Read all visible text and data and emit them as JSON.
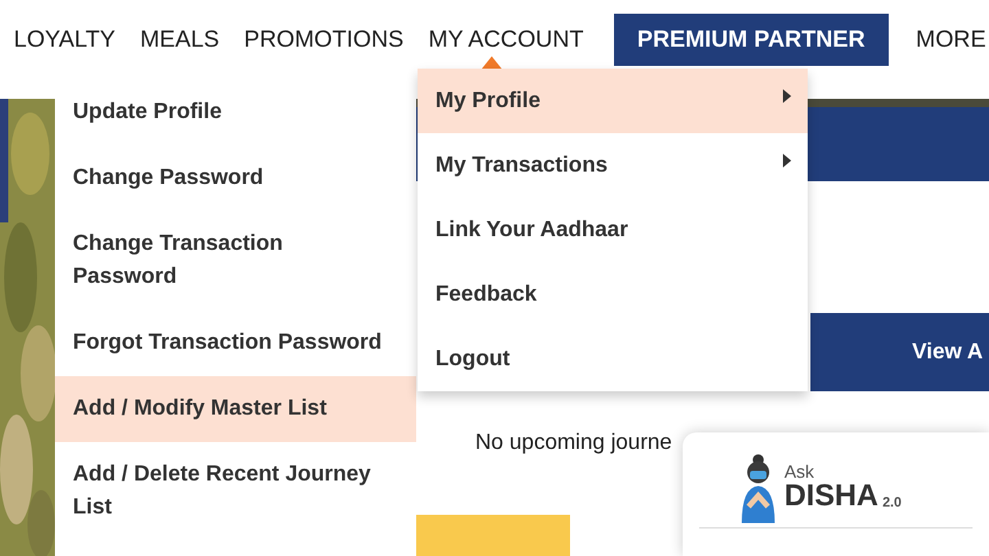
{
  "nav": [
    {
      "label": "LOYALTY",
      "kind": "link",
      "selected": false
    },
    {
      "label": "MEALS",
      "kind": "link",
      "selected": false
    },
    {
      "label": "PROMOTIONS",
      "kind": "link",
      "selected": false
    },
    {
      "label": "MY ACCOUNT",
      "kind": "link",
      "selected": true
    },
    {
      "label": "PREMIUM PARTNER",
      "kind": "button",
      "selected": false
    },
    {
      "label": "MORE",
      "kind": "link",
      "selected": false
    }
  ],
  "side_menu": [
    {
      "label": "Update Profile",
      "selected": false
    },
    {
      "label": "Change Password",
      "selected": false
    },
    {
      "label": "Change Transaction Password",
      "selected": false
    },
    {
      "label": "Forgot Transaction Password",
      "selected": false
    },
    {
      "label": "Add / Modify Master List",
      "selected": true
    },
    {
      "label": "Add / Delete Recent Journey List",
      "selected": false
    }
  ],
  "dropdown": [
    {
      "label": "My Profile",
      "selected": true,
      "has_submenu": true
    },
    {
      "label": "My Transactions",
      "selected": false,
      "has_submenu": true
    },
    {
      "label": "Link Your Aadhaar",
      "selected": false,
      "has_submenu": false
    },
    {
      "label": "Feedback",
      "selected": false,
      "has_submenu": false
    },
    {
      "label": "Logout",
      "selected": false,
      "has_submenu": false
    }
  ],
  "view_button": "View A",
  "journeys_message": "No upcoming journe",
  "chatbot": {
    "ask": "Ask",
    "name": "DISHA",
    "version": "2.0"
  }
}
